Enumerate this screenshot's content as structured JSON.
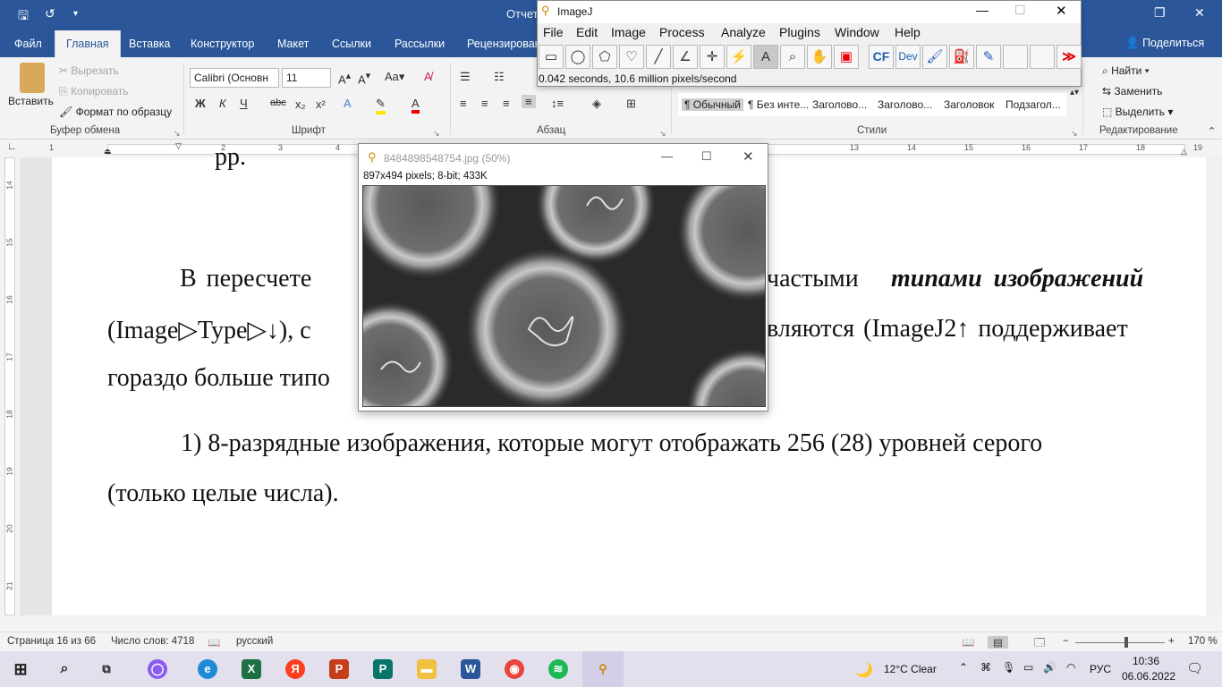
{
  "word": {
    "window_title": "Отчет",
    "tabs": [
      "Файл",
      "Главная",
      "Вставка",
      "Конструктор",
      "Макет",
      "Ссылки",
      "Рассылки",
      "Рецензирован"
    ],
    "share": "Поделиться",
    "clipboard": {
      "paste": "Вставить",
      "cut": "Вырезать",
      "copy": "Копировать",
      "format_painter": "Формат по образцу",
      "group": "Буфер обмена"
    },
    "font": {
      "name": "Calibri (Основн",
      "size": "11",
      "group": "Шрифт"
    },
    "paragraph": {
      "group": "Абзац"
    },
    "styles": {
      "items": [
        "¶ Обычный",
        "¶ Без инте...",
        "Заголово...",
        "Заголово...",
        "Заголовок",
        "Подзагол..."
      ],
      "group": "Стили"
    },
    "editing": {
      "find": "Найти",
      "replace": "Заменить",
      "select": "Выделить",
      "group": "Редактирование"
    },
    "ruler_numbers": [
      "1",
      "2",
      "3",
      "4",
      "13",
      "14",
      "15",
      "16",
      "17",
      "18",
      "19"
    ],
    "vruler_numbers": [
      "14",
      "15",
      "16",
      "17",
      "18",
      "19",
      "20",
      "21"
    ],
    "doc_lines": {
      "l0": "рр.",
      "l1a": "В   пересчете",
      "l1b": "частыми",
      "l1c": "типами   изображений",
      "l2a": "(Image▷Type▷↓),  с",
      "l2b": "вляются  (ImageJ2↑  поддерживает",
      "l3": "гораздо больше типо",
      "l4": "1)  8-разрядные  изображения,  которые  могут  отображать  256  (28)  уровней  серого",
      "l5": "(только целые числа)."
    },
    "status": {
      "page": "Страница 16 из 66",
      "words": "Число слов: 4718",
      "lang": "русский",
      "zoom": "170 %"
    }
  },
  "imagej": {
    "title": "ImageJ",
    "menu": [
      "File",
      "Edit",
      "Image",
      "Process",
      "Analyze",
      "Plugins",
      "Window",
      "Help"
    ],
    "status": "0.042 seconds, 10.6 million pixels/second"
  },
  "image_window": {
    "title": "8484898548754.jpg (50%)",
    "info": "897x494 pixels; 8-bit; 433K"
  },
  "taskbar": {
    "weather": "12°C  Clear",
    "lang": "РУС",
    "time": "10:36",
    "date": "06.06.2022"
  }
}
